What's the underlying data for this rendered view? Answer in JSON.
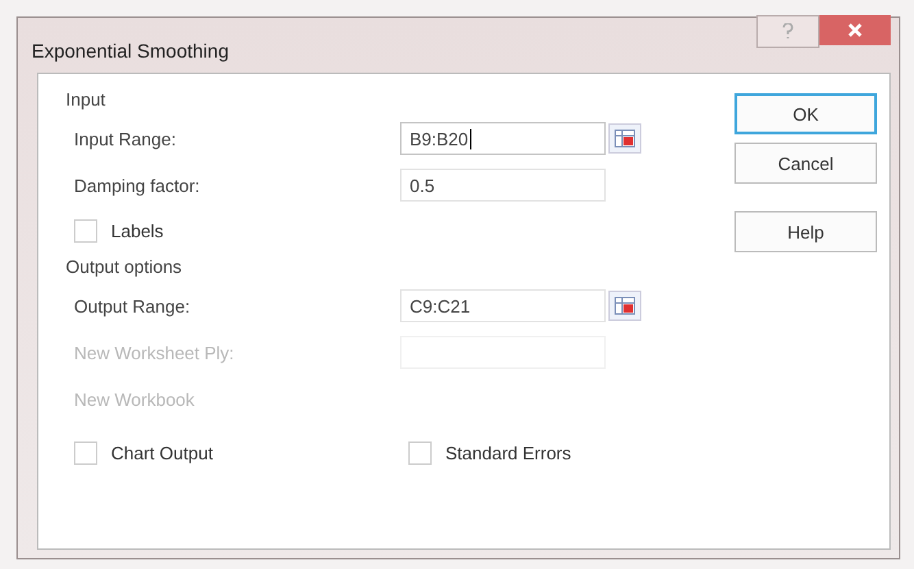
{
  "window": {
    "title": "Exponential Smoothing"
  },
  "input": {
    "heading": "Input",
    "fields": [
      {
        "label": "Input Range:",
        "value": "B9:B20",
        "picker": true,
        "disabled": false,
        "focused": true
      },
      {
        "label": "Damping factor:",
        "value": "0.5",
        "picker": false,
        "disabled": false,
        "focused": false
      }
    ],
    "labels": {
      "label": "Labels",
      "checked": false,
      "disabled": false
    }
  },
  "output": {
    "heading": "Output options",
    "fields": [
      {
        "label": "Output Range:",
        "value": "C9:C21",
        "picker": true,
        "disabled": false,
        "focused": false
      },
      {
        "label": "New Worksheet Ply:",
        "picker": false,
        "disabled": true,
        "focused": false
      },
      {
        "label": "New Workbook",
        "kind": "text",
        "disabled": true
      }
    ],
    "checks": [
      {
        "label": "Chart Output",
        "checked": false,
        "disabled": false
      },
      {
        "label": "Standard Errors",
        "checked": false,
        "disabled": false
      }
    ]
  },
  "buttons": [
    {
      "label": "OK",
      "default": true
    },
    {
      "label": "Cancel",
      "default": false
    },
    {
      "label": "Help",
      "default": false
    }
  ]
}
